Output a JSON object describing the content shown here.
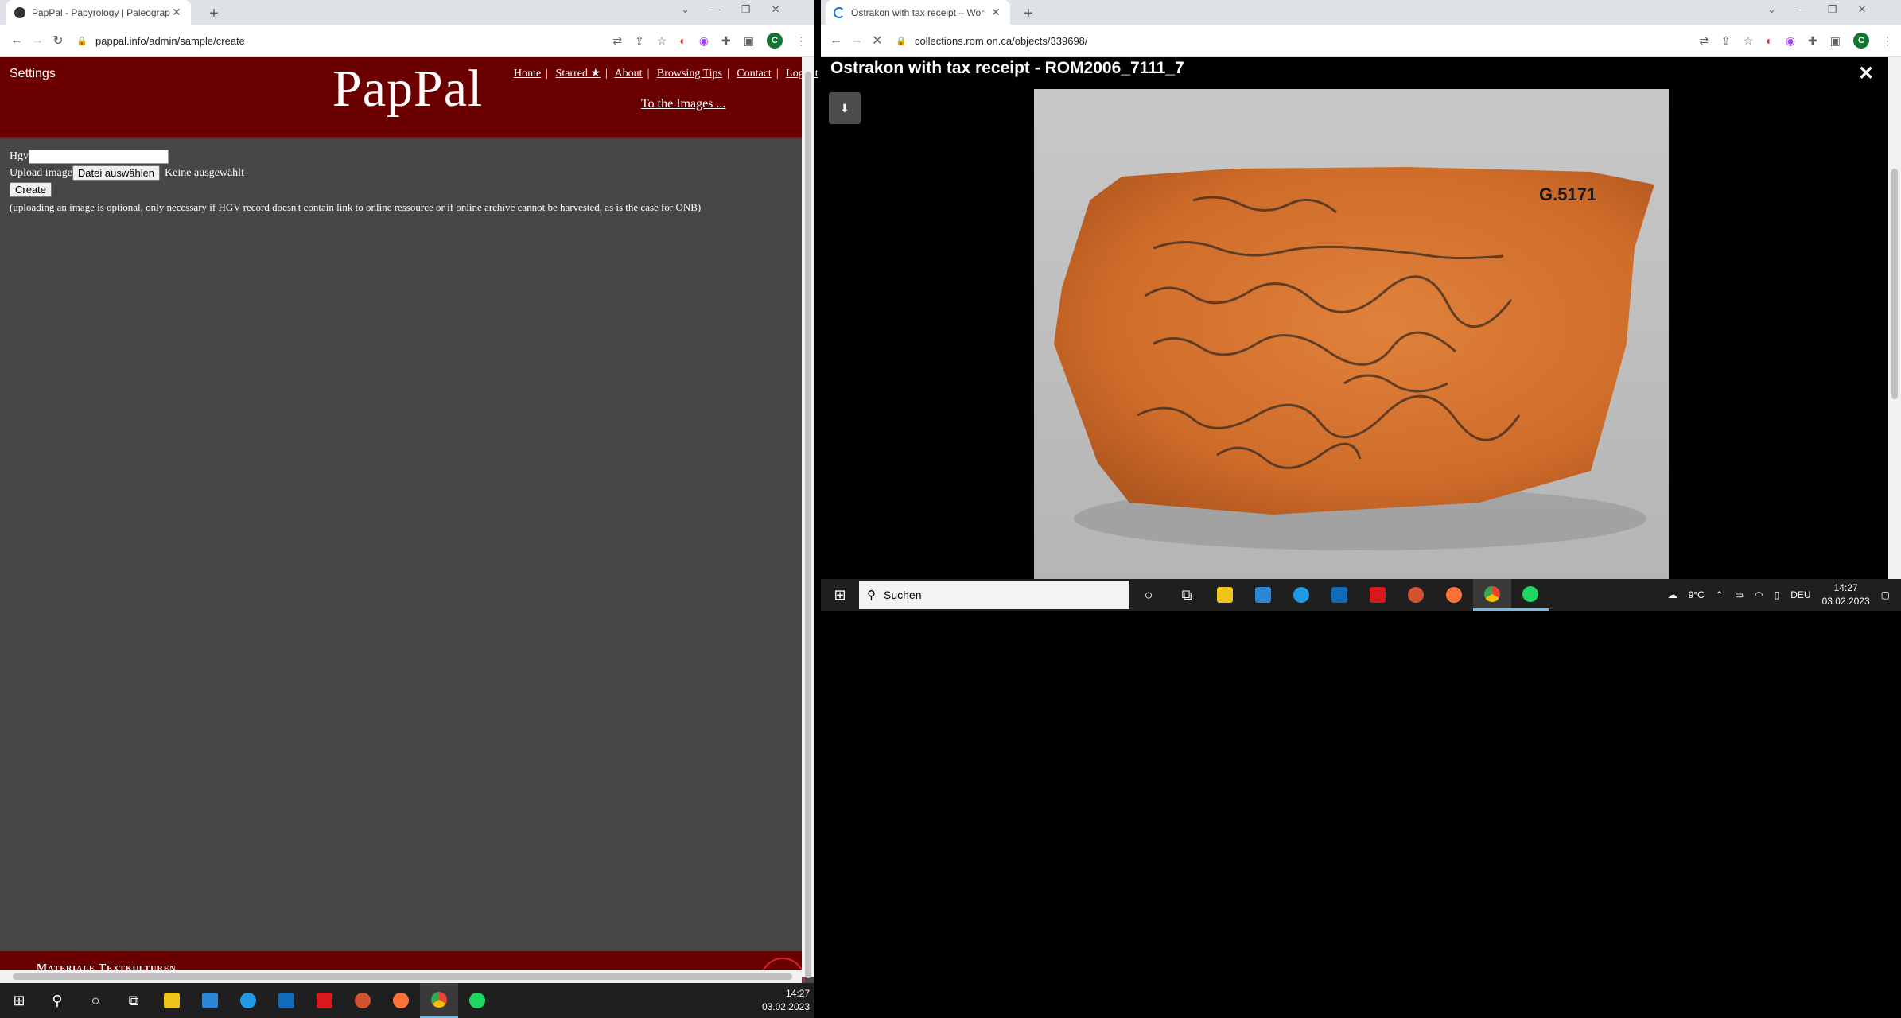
{
  "left_window": {
    "tab_title": "PapPal - Papyrology | Paleograph",
    "url": "pappal.info/admin/sample/create",
    "header": {
      "settings_label": "Settings",
      "logo": "PapPal",
      "nav": [
        "Home",
        "Starred ★",
        "About",
        "Browsing Tips",
        "Contact",
        "Logout"
      ],
      "to_images": "To the Images ..."
    },
    "form": {
      "hgv_label": "Hgv",
      "hgv_value": "",
      "upload_label": "Upload image",
      "file_button": "Datei auswählen",
      "file_status": "Keine ausgewählt",
      "create_button": "Create",
      "note": "(uploading an image is optional, only necessary if HGV record doesn't contain link to online ressource or if online archive cannot be harvested, as is the case for ONB)"
    },
    "footer_text": "Materiale Textkulturen"
  },
  "right_window": {
    "tab_title": "Ostrakon with tax receipt – Worl",
    "url": "collections.rom.on.ca/objects/339698/",
    "viewer_title": "Ostrakon with tax receipt - ROM2006_7111_7",
    "object_label": "G.5171"
  },
  "taskbar_left": {
    "time": "14:27",
    "date": "03.02.2023"
  },
  "taskbar_right": {
    "search_placeholder": "Suchen",
    "weather": "9°C",
    "language": "DEU",
    "time": "14:27",
    "date": "03.02.2023"
  },
  "colors": {
    "header_red": "#6a0000",
    "page_grey": "#474747",
    "accent": "#76b9ed"
  }
}
